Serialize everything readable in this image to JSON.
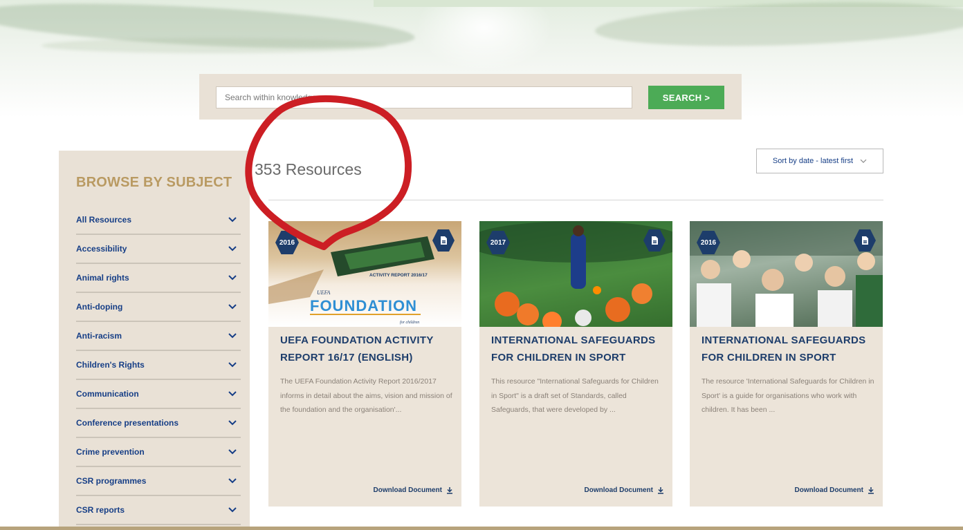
{
  "search": {
    "placeholder": "Search within knowledge",
    "button_label": "SEARCH >"
  },
  "sidebar": {
    "title": "BROWSE BY SUBJECT",
    "items": [
      {
        "label": "All Resources"
      },
      {
        "label": "Accessibility"
      },
      {
        "label": "Animal rights"
      },
      {
        "label": "Anti-doping"
      },
      {
        "label": "Anti-racism"
      },
      {
        "label": "Children's Rights"
      },
      {
        "label": "Communication"
      },
      {
        "label": "Conference presentations"
      },
      {
        "label": "Crime prevention"
      },
      {
        "label": "CSR programmes"
      },
      {
        "label": "CSR reports"
      }
    ]
  },
  "results": {
    "count_text": "353 Resources",
    "sort_label": "Sort by date - latest first"
  },
  "cards": [
    {
      "year": "2016",
      "image_caption": "ACTIVITY REPORT 2016/17",
      "image_logo": "FOUNDATION",
      "image_logo_prefix": "UEFA",
      "image_logo_sub": "for children",
      "title": "UEFA FOUNDATION ACTIVITY REPORT 16/17 (ENGLISH)",
      "description": "The UEFA Foundation Activity Report 2016/2017 informs in detail about the aims, vision and mission of the foundation and the organisation'...",
      "download_label": "Download Document"
    },
    {
      "year": "2017",
      "title": "INTERNATIONAL SAFEGUARDS FOR CHILDREN IN SPORT",
      "description": "This resource \"International Safeguards for Children in Sport\" is a draft set of Standards, called Safeguards, that were developed by ...",
      "download_label": "Download Document"
    },
    {
      "year": "2016",
      "title": "INTERNATIONAL SAFEGUARDS FOR CHILDREN IN SPORT",
      "description": "The resource 'International Safeguards for Children in Sport' is a guide for organisations who work with children. It has been ...",
      "download_label": "Download Document"
    }
  ],
  "colors": {
    "accent_green": "#4cab56",
    "navy": "#1d3d6b",
    "link_blue": "#163e86",
    "gold": "#b99a62",
    "beige": "#e9e1d6",
    "annotation_red": "#cc1e24"
  }
}
